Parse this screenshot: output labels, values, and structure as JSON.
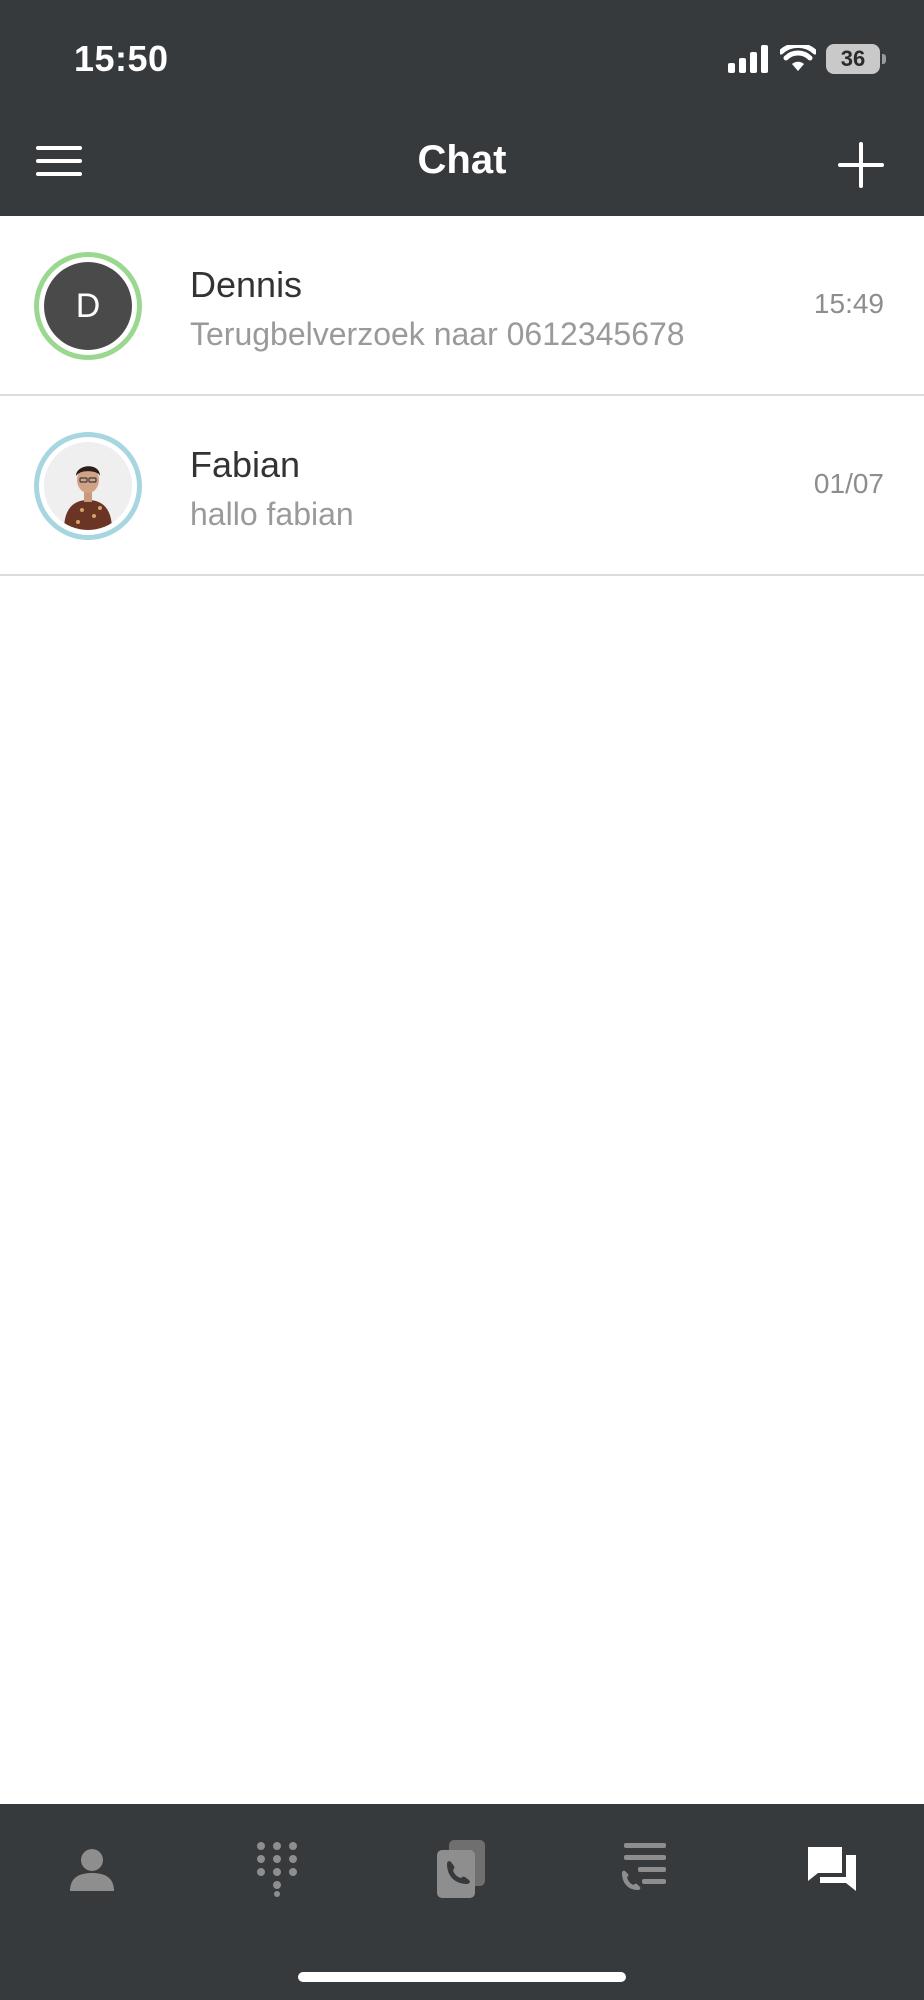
{
  "status_bar": {
    "time": "15:50",
    "battery_level": "36"
  },
  "header": {
    "title": "Chat"
  },
  "chats": [
    {
      "name": "Dennis",
      "initial": "D",
      "last_message": "Terugbelverzoek naar 0612345678",
      "time": "15:49",
      "ring_color": "#9bd88f"
    },
    {
      "name": "Fabian",
      "initial": "",
      "last_message": "hallo fabian",
      "time": "01/07",
      "ring_color": "#a8d6e0"
    }
  ],
  "tab_bar": {
    "items": [
      {
        "icon": "person-icon",
        "active": false
      },
      {
        "icon": "dialpad-icon",
        "active": false
      },
      {
        "icon": "phone-cards-icon",
        "active": false
      },
      {
        "icon": "call-history-icon",
        "active": false
      },
      {
        "icon": "chat-bubbles-icon",
        "active": true
      }
    ],
    "active_color": "#ffffff",
    "inactive_color": "#8e8e8e"
  }
}
